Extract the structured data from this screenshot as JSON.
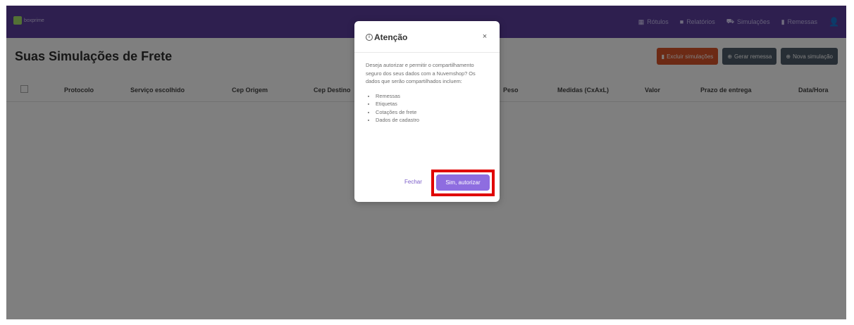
{
  "nav": {
    "logo_text": "boxprime",
    "items": [
      {
        "label": "Rótulos",
        "icon": "grid-icon"
      },
      {
        "label": "Relatórios",
        "icon": "document-icon"
      },
      {
        "label": "Simulações",
        "icon": "truck-icon"
      },
      {
        "label": "Remessas",
        "icon": "box-icon"
      }
    ]
  },
  "page": {
    "title": "Suas Simulações de Frete",
    "actions": {
      "delete_label": "Excluir simulações",
      "generate_label": "Gerar remessa",
      "new_label": "Nova simulação"
    }
  },
  "table": {
    "headers": [
      "Protocolo",
      "Serviço escolhido",
      "Cep Origem",
      "Cep Destino",
      "Peso",
      "Medidas (CxAxL)",
      "Valor",
      "Prazo de entrega",
      "Data/Hora"
    ]
  },
  "modal": {
    "title": "Atenção",
    "close_glyph": "×",
    "intro": "Deseja autorizar e permitir o compartilhamento seguro dos seus dados com a Nuvemshop? Os dados que serão compartilhados incluem:",
    "items": [
      "Remessas",
      "Etiquetas",
      "Cotações de frete",
      "Dados de cadastro"
    ],
    "cancel_label": "Fechar",
    "confirm_label": "Sim, autorizar"
  },
  "colors": {
    "nav_bg": "#5c3f9e",
    "primary": "#8e6de0",
    "danger": "#d9542b",
    "dark": "#4f5d6a",
    "highlight": "#e00000"
  }
}
